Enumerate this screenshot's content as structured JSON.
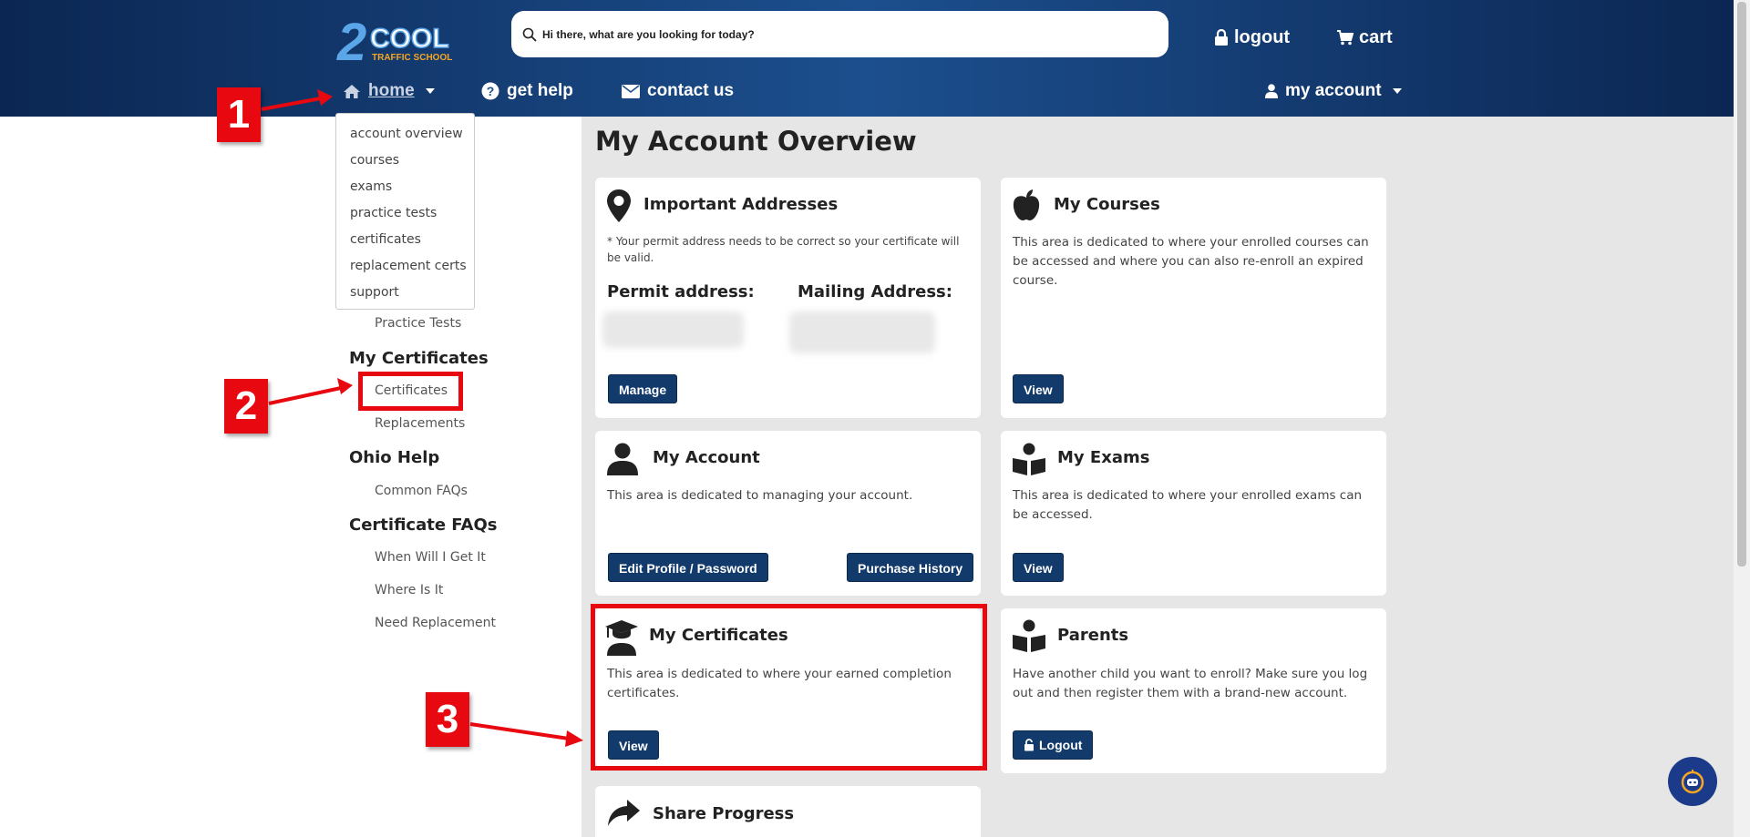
{
  "header": {
    "logo_text": "2COOL",
    "logo_sub": "TRAFFIC SCHOOL",
    "search_placeholder": "Hi there, what are you looking for today?",
    "logout_label": "logout",
    "cart_label": "cart"
  },
  "nav": {
    "home_label": "home",
    "help_label": "get help",
    "contact_label": "contact us",
    "account_label": "my account"
  },
  "dropdown": {
    "items": [
      "account overview",
      "courses",
      "exams",
      "practice tests",
      "certificates",
      "replacement certs",
      "support"
    ]
  },
  "sidebar": {
    "practice_tests": "Practice Tests",
    "my_certificates_head": "My Certificates",
    "certificates": "Certificates",
    "replacements": "Replacements",
    "ohio_help_head": "Ohio Help",
    "common_faqs": "Common FAQs",
    "cert_faqs_head": "Certificate FAQs",
    "when_will": "When Will I Get It",
    "where_is": "Where Is It",
    "need_replacement": "Need Replacement"
  },
  "main": {
    "title": "My Account Overview",
    "addresses": {
      "title": "Important Addresses",
      "note": "* Your permit address needs to be correct so your certificate will be valid.",
      "permit_label": "Permit address:",
      "mailing_label": "Mailing Address:",
      "button": "Manage"
    },
    "courses": {
      "title": "My Courses",
      "text": "This area is dedicated to where your enrolled courses can be accessed and where you can also re-enroll an expired course.",
      "button": "View"
    },
    "account": {
      "title": "My Account",
      "text": "This area is dedicated to managing your account.",
      "button_edit": "Edit Profile / Password",
      "button_history": "Purchase History"
    },
    "exams": {
      "title": "My Exams",
      "text": "This area is dedicated to where your enrolled exams can be accessed.",
      "button": "View"
    },
    "certificates": {
      "title": "My Certificates",
      "text": "This area is dedicated to where your earned completion certificates.",
      "button": "View"
    },
    "parents": {
      "title": "Parents",
      "text": "Have another child you want to enroll? Make sure you log out and then register them with a brand-new account.",
      "button": "Logout"
    },
    "share": {
      "title": "Share Progress"
    }
  },
  "annotations": {
    "step1": "1",
    "step2": "2",
    "step3": "3",
    "color": "#e8080f"
  },
  "colors": {
    "header": "#0b2652",
    "button": "#123a6b",
    "logo_blue": "#5aa6e8",
    "logo_orange": "#f5a623"
  }
}
